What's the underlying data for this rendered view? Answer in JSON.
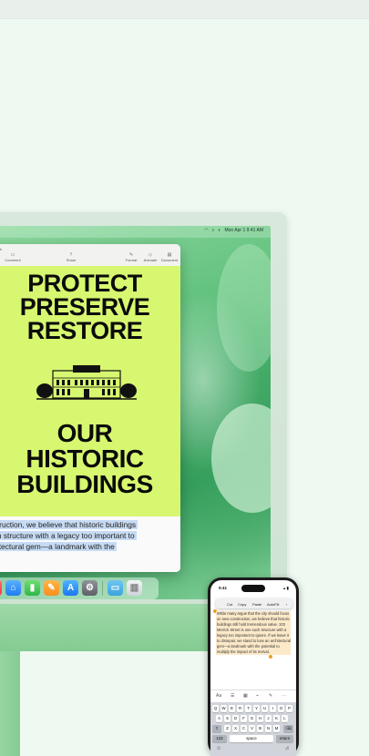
{
  "menubar": {
    "datetime": "Mon Apr 1  9:41 AM",
    "icons": [
      "wifi-icon",
      "search-icon",
      "control-center-icon"
    ]
  },
  "document": {
    "title_fragment": "ation",
    "toolbar_items": [
      {
        "label": "Comment",
        "icon": "comment-icon"
      },
      {
        "label": "Share",
        "icon": "share-icon"
      },
      {
        "label": "Format",
        "icon": "format-icon"
      },
      {
        "label": "Animate",
        "icon": "animate-icon"
      },
      {
        "label": "Document",
        "icon": "document-icon"
      }
    ],
    "poster": {
      "background": "#d7f770",
      "headline_lines": [
        "PROTECT",
        "PRESERVE",
        "RESTORE"
      ],
      "subhead_lines": [
        "OUR",
        "HISTORIC",
        "BUILDINGS"
      ]
    },
    "body_lines": [
      "nstruction, we believe that historic buildings",
      "uch structure with a legacy too important to",
      "chitectural gem—a landmark with the"
    ],
    "selection_color": "#c6dbf3"
  },
  "dock": {
    "apps": [
      "music-icon",
      "keynote-icon",
      "numbers-icon",
      "pages-icon",
      "app-store-icon",
      "system-settings-icon",
      "downloads-folder-icon",
      "trash-icon"
    ]
  },
  "phone": {
    "time": "9:41",
    "edit_menu": [
      "Cut",
      "Copy",
      "Paste",
      "AutoFill"
    ],
    "text_lines": [
      "While many argue that the city should focus",
      "on new construction, we believe that historic",
      "buildings still hold tremendous value. 103",
      "Merrick Street is one such structure with a",
      "legacy too important to ignore. If we leave it",
      "to disrepair, we stand to lose an architectural",
      "gem—a landmark with the potential to",
      "multiply the impact of its revival."
    ],
    "format_bar": [
      "Aa"
    ],
    "keyboard": {
      "row1": [
        "Q",
        "W",
        "E",
        "R",
        "T",
        "Y",
        "U",
        "I",
        "O",
        "P"
      ],
      "row2": [
        "A",
        "S",
        "D",
        "F",
        "G",
        "H",
        "J",
        "K",
        "L"
      ],
      "row3": [
        "Z",
        "X",
        "C",
        "V",
        "B",
        "N",
        "M"
      ],
      "numbers_key": "123",
      "space_key": "space",
      "return_key": "return"
    }
  }
}
